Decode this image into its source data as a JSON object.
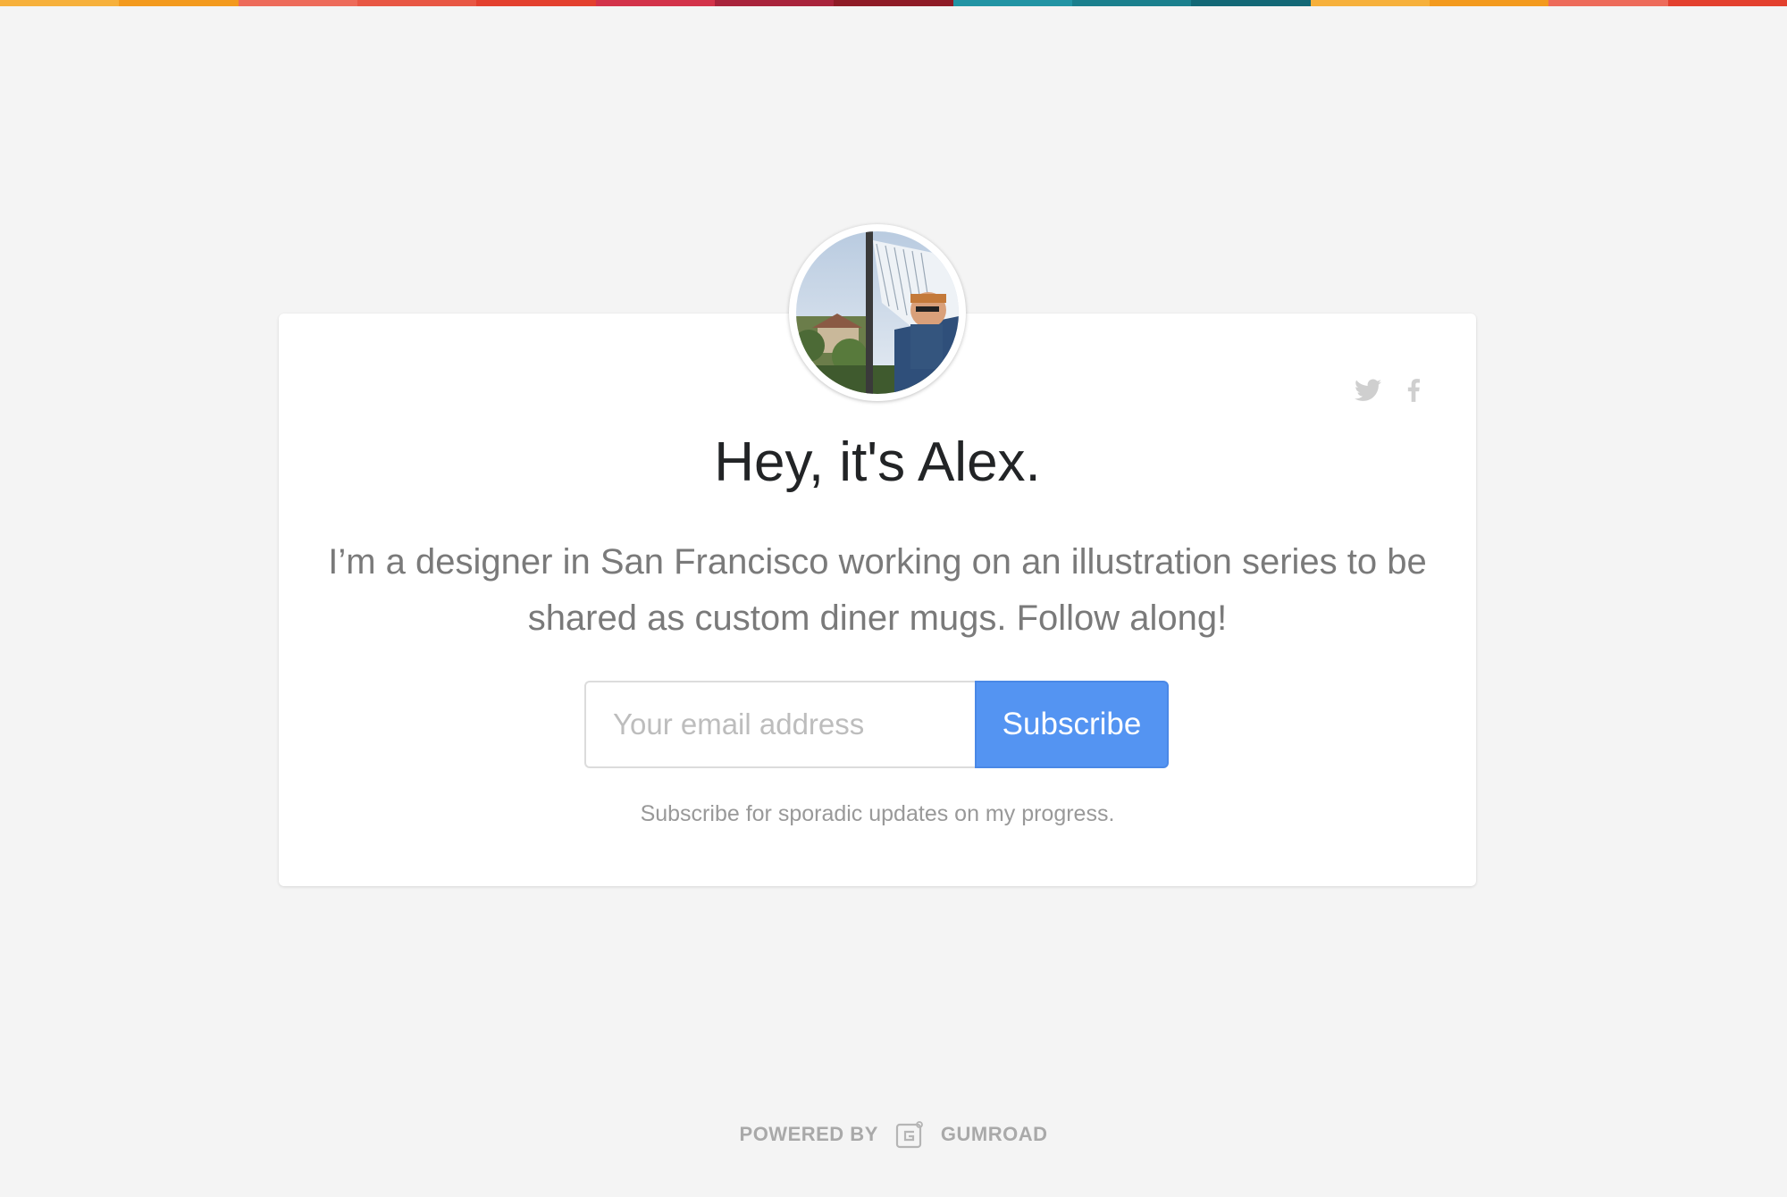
{
  "colors": {
    "background": "#f4f4f4",
    "card": "#ffffff",
    "title": "#222426",
    "bio": "#7a7a7a",
    "button": "#5494f2",
    "button_text": "#ffffff",
    "muted": "#999999",
    "stripe": [
      "#f6b03b",
      "#f39a1e",
      "#ed6b5a",
      "#e85744",
      "#e3402e",
      "#d3334a",
      "#a8233b",
      "#8e1b26",
      "#2294a4",
      "#1a7f8d",
      "#136876",
      "#f6b03b",
      "#f39a1e",
      "#ed6b5a",
      "#e3402e"
    ]
  },
  "profile": {
    "avatar_icon": "profile-photo-hammock",
    "title": "Hey, it's Alex.",
    "bio": "I’m a designer in San Francisco working on an illustration series to be shared as custom diner mugs. Follow along!"
  },
  "social": {
    "twitter_icon": "twitter-icon",
    "facebook_icon": "facebook-icon"
  },
  "form": {
    "email_placeholder": "Your email address",
    "email_value": "",
    "subscribe_label": "Subscribe",
    "note": "Subscribe for sporadic updates on my progress."
  },
  "footer": {
    "powered_by": "POWERED BY",
    "brand": "GUMROAD",
    "logo_icon": "gumroad-logo-icon"
  }
}
